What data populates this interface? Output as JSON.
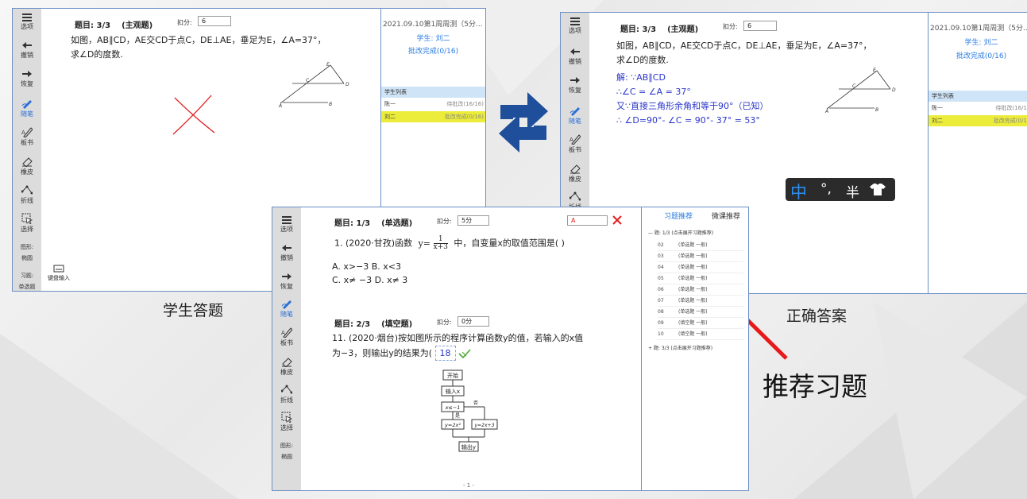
{
  "toolbar": {
    "items": [
      "选项",
      "撤销",
      "恢复",
      "随笔",
      "板书",
      "橡皮",
      "折线",
      "选择"
    ],
    "shape_label": "图形:",
    "shape_value": "椭圆",
    "exercise_label": "习题:",
    "exercise_value": "单选题",
    "keyboard_label": "键盘输入"
  },
  "left_panel": {
    "question_head": "题目: 3/3",
    "question_type": "(主观题)",
    "score_label": "扣分:",
    "score_value": "6",
    "question_line1": "如图，AB∥CD，AE交CD于点C，DE⊥AE，垂足为E，∠A=37°，",
    "question_line2": "求∠D的度数.",
    "figure_labels": [
      "E",
      "C",
      "D",
      "A",
      "B"
    ],
    "right": {
      "title": "2021.09.10第1周周测（5分...",
      "student": "学生: 刘二",
      "status": "批改完成(0/16)",
      "list_header": "学生列表",
      "rows": [
        {
          "name": "陈一",
          "status": "待批改(16/16)"
        },
        {
          "name": "刘二",
          "status": "批改完成(0/16)"
        }
      ]
    }
  },
  "right_panel": {
    "question_head": "题目: 3/3",
    "question_type": "(主观题)",
    "score_label": "扣分:",
    "score_value": "6",
    "question_line1": "如图，AB∥CD，AE交CD于点C，DE⊥AE，垂足为E，∠A=37°，",
    "question_line2": "求∠D的度数.",
    "answer_lines": [
      "解: ∵AB∥CD",
      "∴∠C = ∠A = 37°",
      "又∵直接三角形余角和等于90°（已知）",
      "∴ ∠D=90°- ∠C  =  90°- 37° =  53°"
    ],
    "right": {
      "title": "2021.09.10第1周周测（5分...",
      "student": "学生: 刘二",
      "status": "批改完成(0/16)",
      "list_header": "学生列表",
      "rows": [
        {
          "name": "陈一",
          "status": "待批改(16/16)"
        },
        {
          "name": "刘二",
          "status": "批改完成(0/16)"
        }
      ]
    },
    "ime": {
      "mode": "中",
      "punct": "°,",
      "width": "半"
    }
  },
  "center_panel": {
    "q1": {
      "head": "题目: 1/3",
      "type": "(单选题)",
      "score_label": "扣分:",
      "score_value": "5分",
      "answer_box": "A",
      "text_prefix": "1. (2020·甘孜)函数",
      "formula_lhs": "y=",
      "formula_num": "1",
      "formula_den": "x+3",
      "text_suffix": "中，自变量x的取值范围是(    )",
      "options_line1": "A. x>−3   B. x<3",
      "options_line2": "C. x≠ −3   D. x≠ 3"
    },
    "q2": {
      "head": "题目: 2/3",
      "type": "(填空题)",
      "score_label": "扣分:",
      "score_value": "0分",
      "text_line1": "11. (2020·烟台)按如图所示的程序计算函数y的值，若输入的x值",
      "text_line2": "为−3，则输出y的结果为(",
      "answer": "18",
      "flow": {
        "start": "开始",
        "input": "输入x",
        "cond": "x≤−1",
        "yes": "是",
        "no": "否",
        "left": "y=2x²",
        "right": "y=2x+3",
        "output": "输出y"
      }
    },
    "page_num": "- 1 -",
    "suggest": {
      "tab_active": "习题推荐",
      "tab_other": "微课推荐",
      "group1": "— 题: 1/3 (点击展开习题推荐)",
      "rows": [
        {
          "no": "02",
          "type": "(单选题 一般)"
        },
        {
          "no": "03",
          "type": "(单选题 一般)"
        },
        {
          "no": "04",
          "type": "(单选题 一般)"
        },
        {
          "no": "05",
          "type": "(单选题 一般)"
        },
        {
          "no": "06",
          "type": "(单选题 一般)"
        },
        {
          "no": "07",
          "type": "(单选题 一般)"
        },
        {
          "no": "08",
          "type": "(单选题 一般)"
        },
        {
          "no": "09",
          "type": "(填空题 一般)"
        },
        {
          "no": "10",
          "type": "(填空题 一般)"
        }
      ],
      "group2": "+ 题: 3/3 (点击展开习题推荐)"
    }
  },
  "captions": {
    "student": "学生答题",
    "correct": "正确答案",
    "recommend": "推荐习题"
  },
  "colors": {
    "accent": "#2b7be0",
    "panel_border": "#6b8fc7",
    "answer_blue": "#2a35c9",
    "wrong_red": "#e02020",
    "arrow_red": "#e8191b",
    "swap_blue": "#1f4f9a",
    "highlight": "#ecec3a"
  }
}
